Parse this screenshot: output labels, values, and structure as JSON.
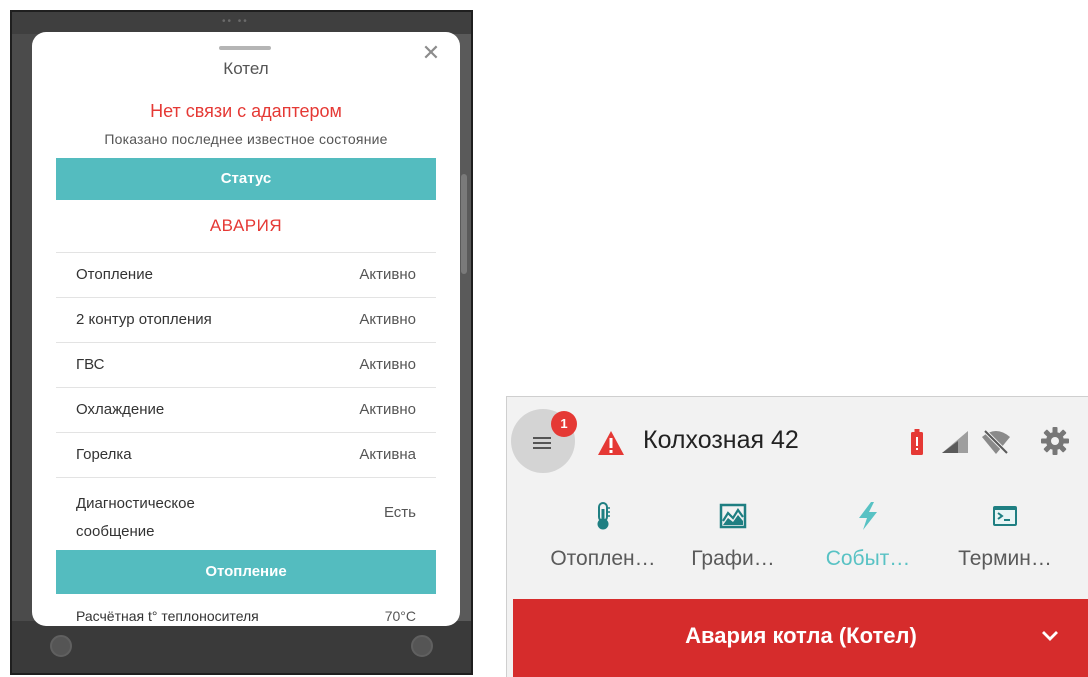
{
  "modal": {
    "title": "Котел",
    "close_icon": "close-icon",
    "error": "Нет связи с адаптером",
    "subtitle": "Показано последнее известное состояние",
    "status_section": "Статус",
    "status_value": "АВАРИЯ",
    "rows": [
      {
        "label": "Отопление",
        "value": "Активно"
      },
      {
        "label": "2 контур отопления",
        "value": "Активно"
      },
      {
        "label": "ГВС",
        "value": "Активно"
      },
      {
        "label": "Охлаждение",
        "value": "Активно"
      },
      {
        "label": "Горелка",
        "value": "Активна"
      },
      {
        "label": "Диагностическое сообщение",
        "value": "Есть"
      }
    ],
    "heating_section": "Отопление",
    "partial_row": {
      "label": "Расчётная t° теплоносителя",
      "value": "70°C"
    }
  },
  "header": {
    "menu_icon": "hamburger-menu-icon",
    "notification_count": "1",
    "warning_icon": "warning-triangle-icon",
    "title": "Колхозная 42",
    "status_icons": [
      "battery-alert-icon",
      "cellular-signal-icon",
      "wifi-off-icon",
      "gear-icon"
    ]
  },
  "nav": {
    "items": [
      {
        "label": "Отоплен…",
        "icon": "thermometer-icon",
        "active": false
      },
      {
        "label": "Графи…",
        "icon": "chart-icon",
        "active": false
      },
      {
        "label": "Событ…",
        "icon": "lightning-icon",
        "active": true
      },
      {
        "label": "Термин…",
        "icon": "terminal-icon",
        "active": false
      }
    ]
  },
  "alarm_bar": {
    "text": "Авария котла (Котел)",
    "icon": "chevron-down-icon"
  },
  "colors": {
    "accent": "#54bcbf",
    "error": "#e53935",
    "alarm": "#d62c2c",
    "active_tab": "#58c2c4"
  }
}
